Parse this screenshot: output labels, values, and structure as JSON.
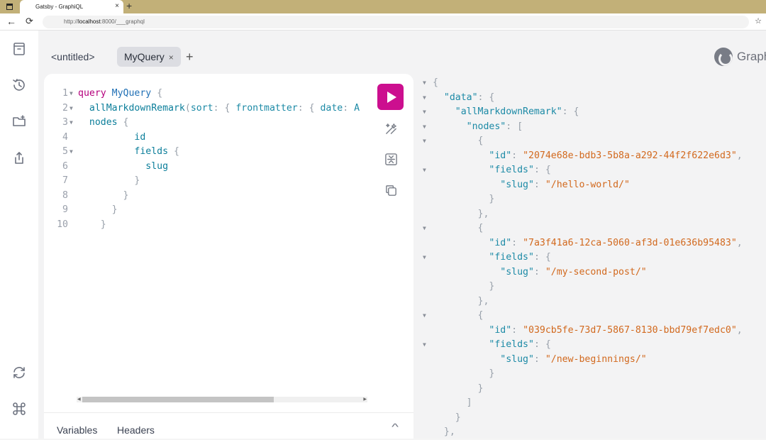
{
  "browser": {
    "tab_title": "Gatsby - GraphiQL",
    "tab_close": "×",
    "new_tab": "+",
    "url_prefix": "http://",
    "url_host": "localhost",
    "url_rest": ":8000/___graphql",
    "back": "←",
    "reload": "⟳",
    "favorites": "☆"
  },
  "tabs": {
    "untitled": "<untitled>",
    "active": "MyQuery",
    "close": "×",
    "add": "+"
  },
  "logo_text": "Graph",
  "query_lines": [
    {
      "n": "1",
      "fold": "▼"
    },
    {
      "n": "2",
      "fold": "▼"
    },
    {
      "n": "3",
      "fold": "▼"
    },
    {
      "n": "4",
      "fold": ""
    },
    {
      "n": "5",
      "fold": "▼"
    },
    {
      "n": "6",
      "fold": ""
    },
    {
      "n": "7",
      "fold": ""
    },
    {
      "n": "8",
      "fold": ""
    },
    {
      "n": "9",
      "fold": ""
    },
    {
      "n": "10",
      "fold": ""
    }
  ],
  "query_tokens": {
    "kw_query": "query",
    "op_name": "MyQuery",
    "all_field": "allMarkdownRemark",
    "sort_arg": "sort",
    "frontmatter_arg": "frontmatter",
    "date_arg": "date",
    "date_val": "A",
    "nodes": "nodes",
    "id": "id",
    "fields": "fields",
    "slug": "slug"
  },
  "bottom_tabs": {
    "variables": "Variables",
    "headers": "Headers"
  },
  "result": {
    "data_key": "\"data\"",
    "all_key": "\"allMarkdownRemark\"",
    "nodes_key": "\"nodes\"",
    "id_key": "\"id\"",
    "fields_key": "\"fields\"",
    "slug_key": "\"slug\"",
    "nodes": [
      {
        "id": "\"2074e68e-bdb3-5b8a-a292-44f2f622e6d3\"",
        "slug": "\"/hello-world/\""
      },
      {
        "id": "\"7a3f41a6-12ca-5060-af3d-01e636b95483\"",
        "slug": "\"/my-second-post/\""
      },
      {
        "id": "\"039cb5fe-73d7-5867-8130-bbd79ef7edc0\"",
        "slug": "\"/new-beginnings/\""
      }
    ]
  },
  "colors": {
    "run_button": "#cc0f8f",
    "keyword": "#b4007c",
    "string": "#d2691e",
    "key": "#1c8aa6"
  }
}
